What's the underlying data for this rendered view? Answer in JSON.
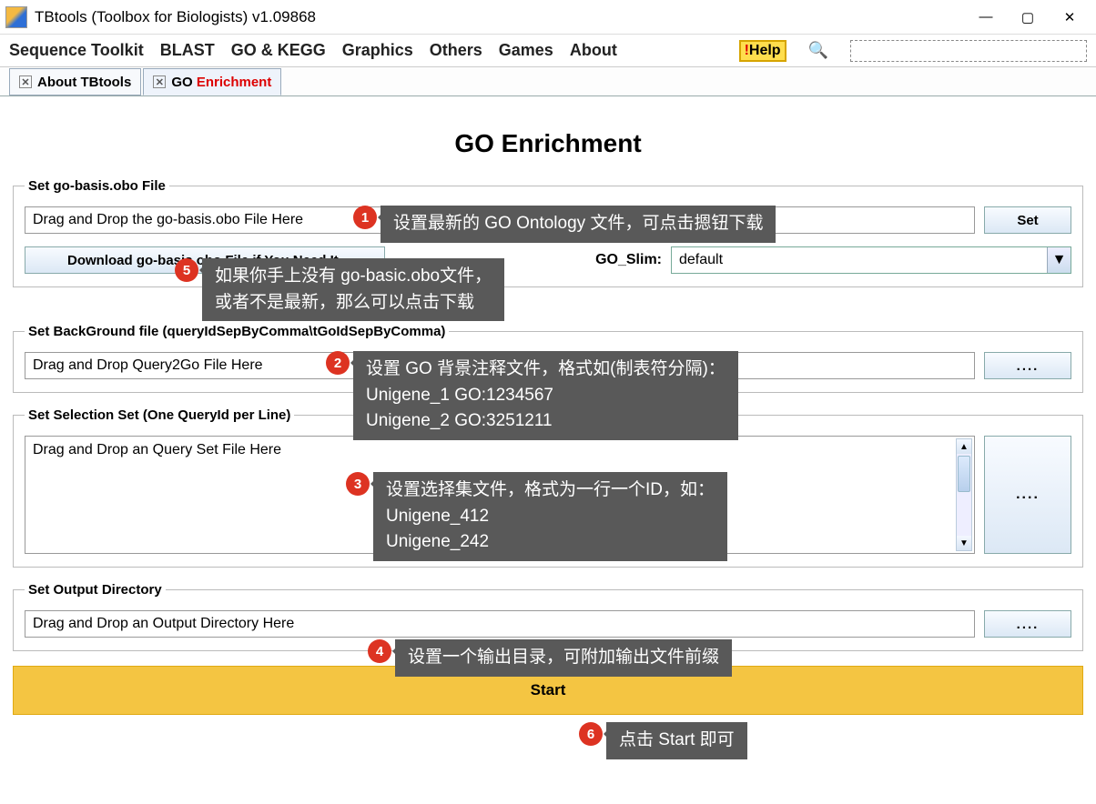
{
  "window": {
    "title": "TBtools (Toolbox for Biologists) v1.09868"
  },
  "menubar": {
    "items": [
      "Sequence Toolkit",
      "BLAST",
      "GO & KEGG",
      "Graphics",
      "Others",
      "Games",
      "About"
    ],
    "help_label": "Help"
  },
  "tabs": {
    "about": "About TBtools",
    "go_prefix": "GO ",
    "go_suffix": "Enrichment"
  },
  "page": {
    "title": "GO Enrichment",
    "section1_legend": "Set go-basis.obo File",
    "section1_placeholder": "Drag and Drop the go-basis.obo File Here",
    "set_button": "Set",
    "download_button": "Download go-basis.obo File if You Need It.",
    "goslim_label": "GO_Slim:",
    "goslim_value": "default",
    "section2_legend": "Set BackGround file (queryIdSepByComma\\tGoIdSepByComma)",
    "section2_placeholder": "Drag and Drop Query2Go File Here",
    "browse_button": "....",
    "section3_legend": "Set Selection Set (One QueryId per Line)",
    "section3_placeholder": "Drag and Drop an Query Set File Here",
    "section4_legend": "Set Output Directory",
    "section4_placeholder": "Drag and Drop an Output Directory Here",
    "start_button": "Start"
  },
  "callouts": {
    "c1": "设置最新的 GO Ontology 文件，可点击摁钮下载",
    "c2_l1": "设置 GO 背景注释文件，格式如(制表符分隔)：",
    "c2_l2": "Unigene_1    GO:1234567",
    "c2_l3": "Unigene_2    GO:3251211",
    "c3_l1": "设置选择集文件，格式为一行一个ID，如：",
    "c3_l2": "Unigene_412",
    "c3_l3": "Unigene_242",
    "c4": "设置一个输出目录，可附加输出文件前缀",
    "c5_l1": "如果你手上没有 go-basic.obo文件，",
    "c5_l2": "或者不是最新，那么可以点击下载",
    "c6": "点击 Start 即可"
  }
}
